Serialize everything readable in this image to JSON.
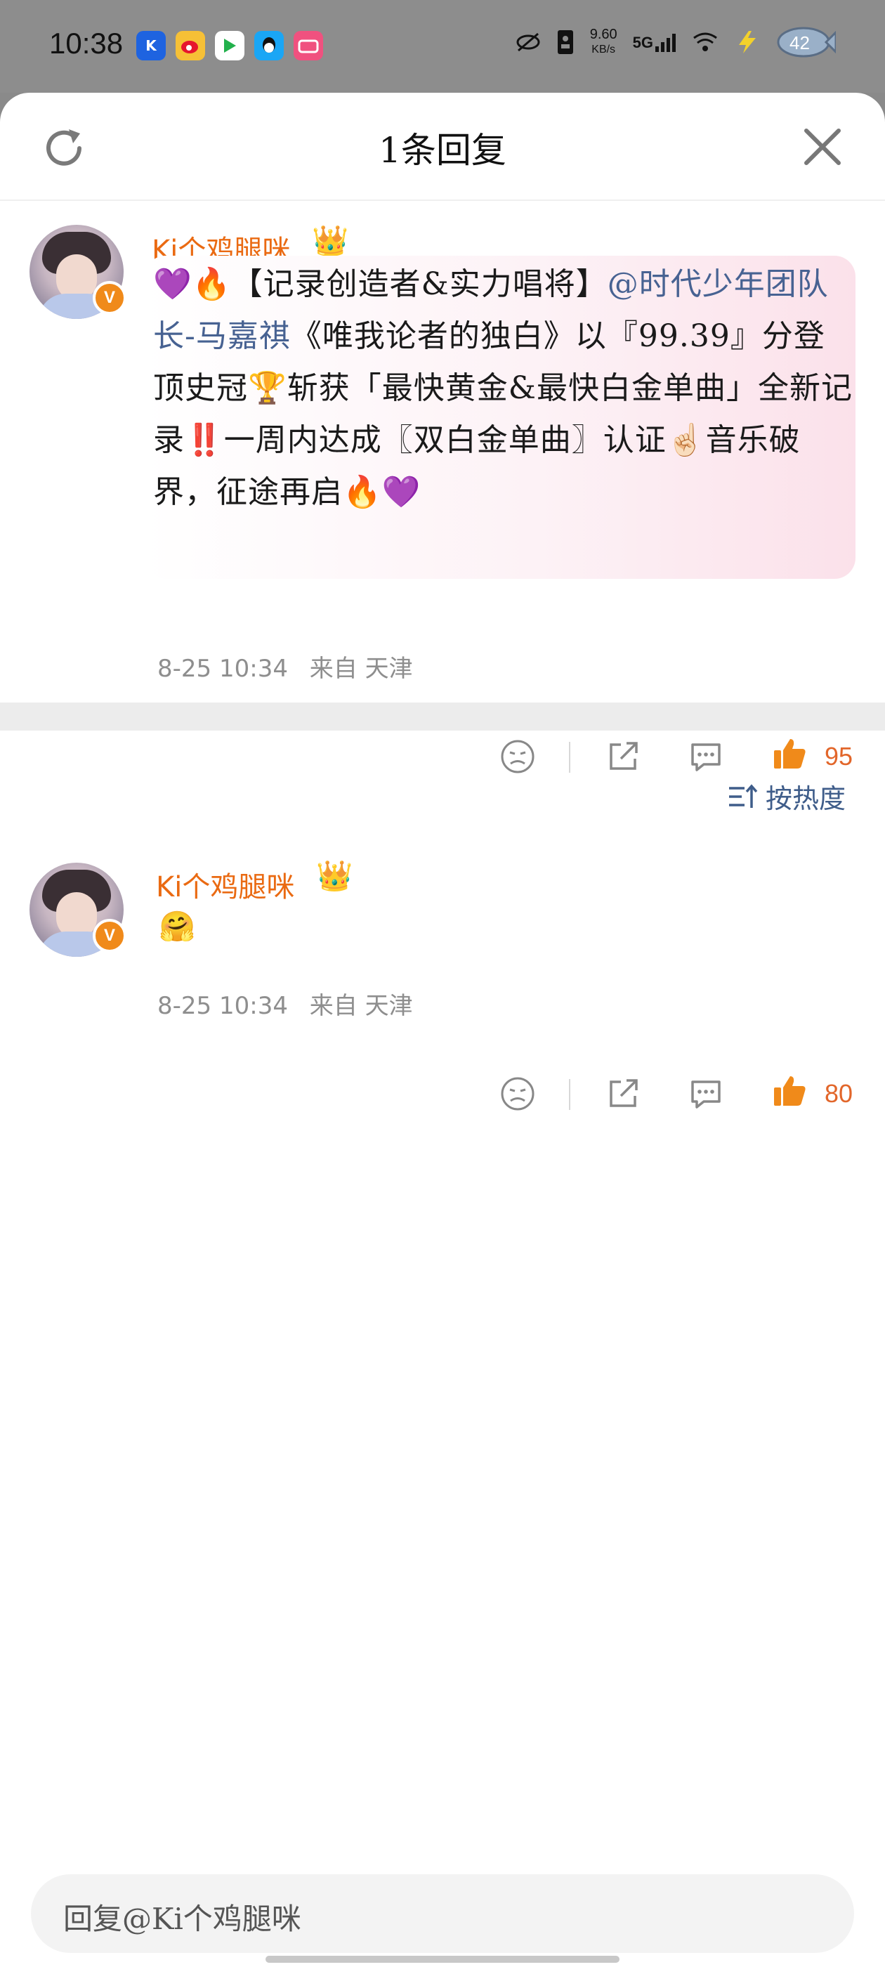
{
  "status_bar": {
    "time": "10:38",
    "net_speed": "9.60",
    "net_unit": "KB/s",
    "signal": "5G",
    "battery": "42",
    "app_icons": [
      "kuaishou-icon",
      "weibo-icon",
      "play-store-icon",
      "qq-icon",
      "bilibili-icon"
    ]
  },
  "header": {
    "title": "1条回复",
    "refresh_icon": "refresh-icon",
    "close_icon": "close-icon"
  },
  "root_comment": {
    "username": "Ki个鸡腿咪",
    "badge": "V",
    "text_parts": {
      "p1": "💜🔥【记录创造者&实力唱将】",
      "mention": "@时代少年团队长-马嘉祺",
      "p2": "《唯我论者的独白》以『99.39』分登顶史冠🏆斩获「最快黄金&最快白金单曲」全新记录‼️一周内达成〖双白金单曲〗认证☝🏻音乐破界，征途再启🔥💜"
    },
    "timestamp": "8-25 10:34",
    "location": "来自 天津",
    "likes": "95"
  },
  "sort": {
    "label": "按热度"
  },
  "replies": [
    {
      "username": "Ki个鸡腿咪",
      "badge": "V",
      "emoji": "🤗",
      "timestamp": "8-25 10:34",
      "location": "来自 天津",
      "likes": "80"
    }
  ],
  "reply_box": {
    "placeholder": "回复@Ki个鸡腿咪"
  },
  "colors": {
    "username": "#ea6a12",
    "mention": "#476292",
    "like": "#e2662a",
    "sort": "#3f5d8a"
  }
}
